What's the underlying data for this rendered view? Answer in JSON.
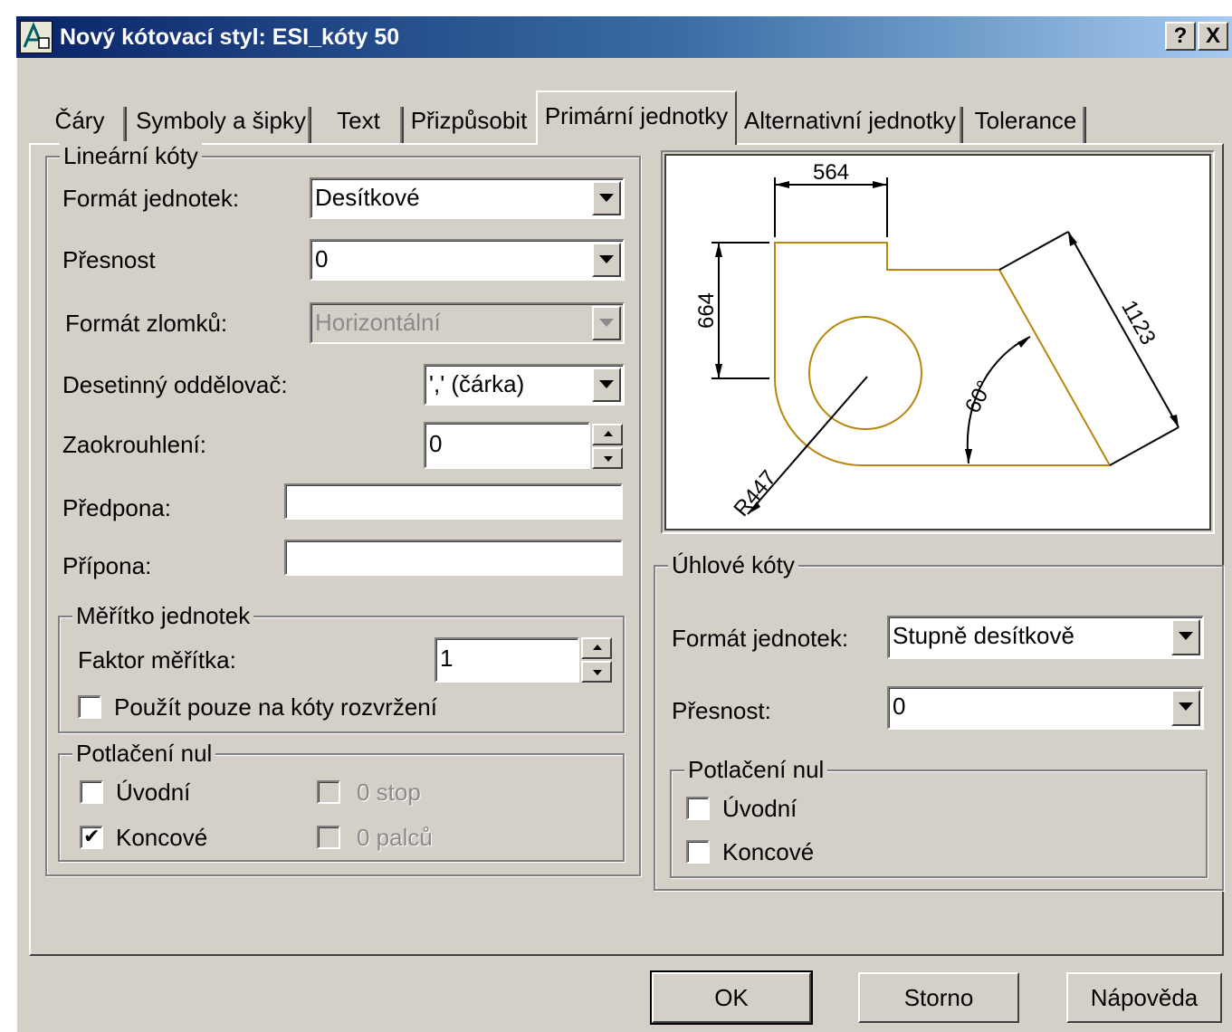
{
  "title": "Nový kótovací styl: ESI_kóty 50",
  "title_buttons": {
    "help": "?",
    "close": "X"
  },
  "tabs": [
    {
      "label": "Čáry"
    },
    {
      "label": "Symboly a šipky"
    },
    {
      "label": "Text"
    },
    {
      "label": "Přizpůsobit"
    },
    {
      "label": "Primární jednotky",
      "active": true
    },
    {
      "label": "Alternativní jednotky"
    },
    {
      "label": "Tolerance"
    }
  ],
  "linear": {
    "group_label": "Lineární kóty",
    "unit_format": {
      "label": "Formát jednotek:",
      "value": "Desítkové"
    },
    "precision": {
      "label": "Přesnost",
      "value": "0"
    },
    "fraction_format": {
      "label": "Formát zlomků:",
      "value": "Horizontální",
      "disabled": true
    },
    "decimal_separator": {
      "label": "Desetinný oddělovač:",
      "value": "',' (čárka)"
    },
    "round_off": {
      "label": "Zaokrouhlení:",
      "value": "0"
    },
    "prefix": {
      "label": "Předpona:",
      "value": ""
    },
    "suffix": {
      "label": "Přípona:",
      "value": ""
    },
    "scale": {
      "group_label": "Měřítko jednotek",
      "factor_label": "Faktor měřítka:",
      "factor_value": "1",
      "layout_only_label": "Použít pouze na kóty rozvržení",
      "layout_only_checked": false
    },
    "zero_suppression": {
      "group_label": "Potlačení nul",
      "leading_label": "Úvodní",
      "leading_checked": false,
      "trailing_label": "Koncové",
      "trailing_checked": true,
      "feet_label": "0 stop",
      "inches_label": "0 palců"
    }
  },
  "preview": {
    "dim_top": "564",
    "dim_left": "664",
    "dim_diag": "1123",
    "dim_angle": "60°",
    "dim_radius": "R447",
    "line_color": "#b8860b"
  },
  "angular": {
    "group_label": "Úhlové kóty",
    "unit_format": {
      "label": "Formát jednotek:",
      "value": "Stupně desítkově"
    },
    "precision": {
      "label": "Přesnost:",
      "value": "0"
    },
    "zero_suppression": {
      "group_label": "Potlačení nul",
      "leading_label": "Úvodní",
      "leading_checked": false,
      "trailing_label": "Koncové",
      "trailing_checked": false
    }
  },
  "buttons": {
    "ok": "OK",
    "cancel": "Storno",
    "help": "Nápověda"
  }
}
